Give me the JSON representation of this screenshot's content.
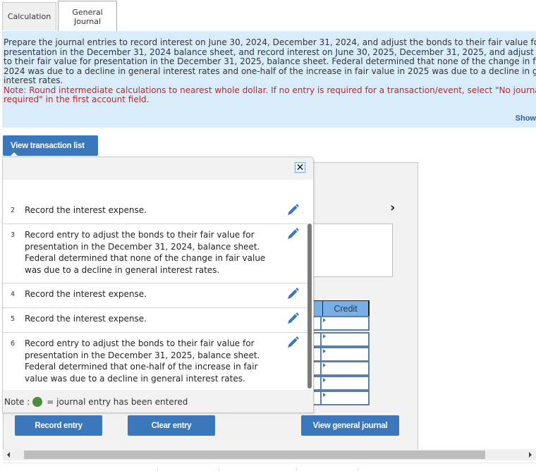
{
  "tabs": [
    {
      "label": "Calculation",
      "active": false
    },
    {
      "label": "General Journal",
      "active": true
    }
  ],
  "instructions": {
    "lines": [
      "Prepare the journal entries to record interest on June 30, 2024, December 31, 2024, and adjust the bonds to their fair value for",
      "presentation in the December 31, 2024 balance sheet, and record interest on June 30, 2025, December 31, 2025, and adjust the",
      "to their fair value for presentation in the December 31, 2025, balance sheet. Federal determined that none of the change in fair",
      "2024 was due to a decline in general interest rates and one-half of the increase in fair value in 2025 was due to a decline in gen",
      "interest rates."
    ],
    "note_lines": [
      "Note: Round intermediate calculations to nearest whole dollar. If no entry is required for a transaction/event, select \"No journal",
      "required\" in the first account field."
    ],
    "show_link": "Show"
  },
  "transaction_list": {
    "toggle_label": "View transaction list",
    "items": [
      {
        "number": "2",
        "text": "Record the interest expense."
      },
      {
        "number": "3",
        "text": "Record entry to adjust the bonds to their fair value for presentation in the December 31, 2024, balance sheet. Federal determined that none of the change in fair value was due to a decline in general interest rates."
      },
      {
        "number": "4",
        "text": "Record the interest expense."
      },
      {
        "number": "5",
        "text": "Record the interest expense."
      },
      {
        "number": "6",
        "text": "Record entry to adjust the bonds to their fair value for presentation in the December 31, 2025, balance sheet. Federal determined that one-half of the increase in fair value was due to a decline in general interest rates."
      }
    ],
    "note_prefix": "Note :",
    "note_suffix": "= journal entry has been entered",
    "entered_color": "#4d8b3f"
  },
  "journal": {
    "credit_header": "Credit",
    "row_count": 6
  },
  "buttons": {
    "record_entry": "Record entry",
    "clear_entry": "Clear entry",
    "view_general_journal": "View general journal"
  },
  "colors": {
    "accent": "#3a77bb",
    "instructions_bg": "#d9ecfa",
    "note_red": "#c0242b",
    "grid_header": "#7aaee6"
  }
}
